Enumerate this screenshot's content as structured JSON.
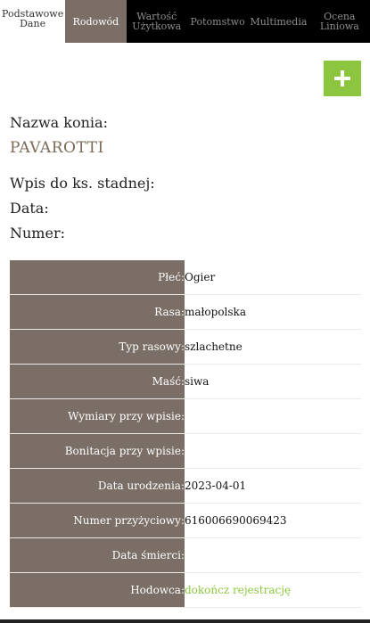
{
  "tabs": [
    {
      "label": "Podstawowe\nDane"
    },
    {
      "label": "Rodowód"
    },
    {
      "label": "Wartość\nUżytkowa"
    },
    {
      "label": "Potomstwo"
    },
    {
      "label": "Multimedia"
    },
    {
      "label": "Ocena\nLiniowa"
    }
  ],
  "add_button": {
    "icon": "plus-icon",
    "color": "#8cc63f",
    "glyph": "+"
  },
  "horse": {
    "name_label": "Nazwa konia:",
    "name": "PAVAROTTI",
    "studbook_label": "Wpis do ks. stadnej:",
    "date_label": "Data:",
    "number_label": "Numer:"
  },
  "details": [
    {
      "label": "Płeć:",
      "value": "Ogier"
    },
    {
      "label": "Rasa:",
      "value": "małopolska"
    },
    {
      "label": "Typ rasowy:",
      "value": "szlachetne"
    },
    {
      "label": "Maść:",
      "value": "siwa"
    },
    {
      "label": "Wymiary przy wpisie:",
      "value": ""
    },
    {
      "label": "Bonitacja przy wpisie:",
      "value": ""
    },
    {
      "label": "Data urodzenia:",
      "value": "2023-04-01"
    },
    {
      "label": "Numer przyżyciowy:",
      "value": "616006690069423"
    },
    {
      "label": "Data śmierci:",
      "value": ""
    },
    {
      "label": "Hodowca:",
      "value": "dokończ rejestrację"
    }
  ],
  "colors": {
    "header_bg": "#000000",
    "active_tab": "#7a6e67",
    "accent_green": "#8cc63f",
    "name_color": "#7a6a55"
  }
}
